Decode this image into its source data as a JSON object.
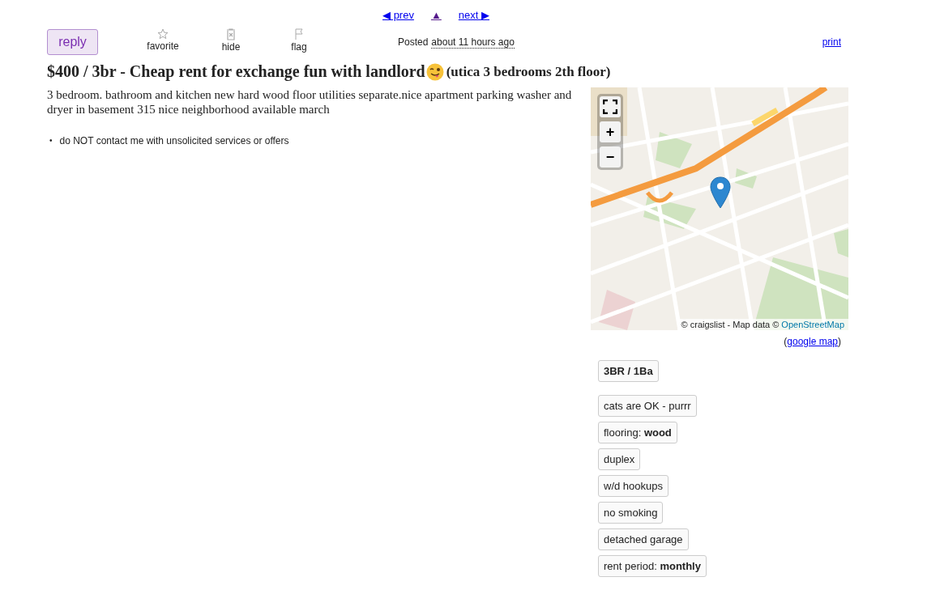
{
  "nav": {
    "prev": "◀ prev",
    "up": "▲",
    "next": "next ▶"
  },
  "toolbar": {
    "reply": "reply",
    "actions": [
      {
        "kind": "favorite",
        "label": "favorite"
      },
      {
        "kind": "hide",
        "label": "hide"
      },
      {
        "kind": "flag",
        "label": "flag"
      }
    ],
    "posted_label": "Posted",
    "posted_time": "about 11 hours ago",
    "print": "print"
  },
  "title": {
    "main": "$400 / 3br - Cheap rent for exchange fun with landlord",
    "location": "(utica 3 bedrooms 2th floor)"
  },
  "body": "3 bedroom. bathroom and kitchen new hard wood floor utilities separate.nice apartment parking washer and dryer in basement 315 nice neighborhood available march",
  "notices": [
    {
      "bullet": "•",
      "text": "do NOT contact me with unsolicited services or offers"
    }
  ],
  "map": {
    "zoom_in": "+",
    "zoom_out": "−",
    "attribution": "© craigslist - Map data ©",
    "attribution_link": "OpenStreetMap",
    "google_open": "(",
    "google_link": "google map",
    "google_close": ")"
  },
  "attribute_groups": [
    [
      {
        "text": "3BR / 1Ba",
        "bold": true
      }
    ],
    [
      {
        "text": "cats are OK - purrr",
        "bold": false
      },
      {
        "text": "flooring: **wood**",
        "bold": false
      },
      {
        "text": "duplex",
        "bold": false
      },
      {
        "text": "w/d hookups",
        "bold": false
      },
      {
        "text": "no smoking",
        "bold": false
      },
      {
        "text": "detached garage",
        "bold": false
      },
      {
        "text": "rent period: **monthly**",
        "bold": false
      }
    ]
  ]
}
